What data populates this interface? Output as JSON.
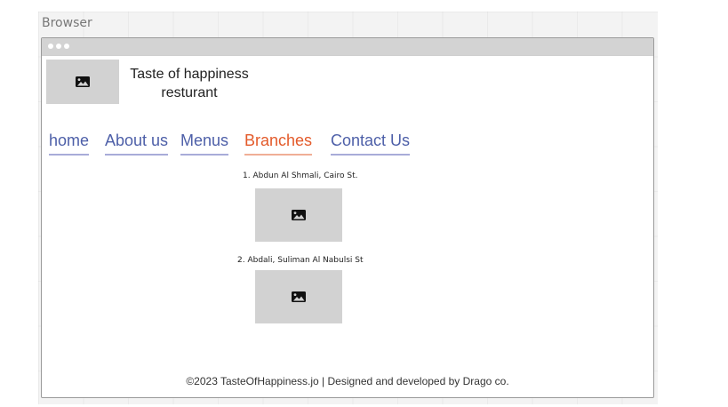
{
  "canvas": {
    "label": "Browser"
  },
  "site": {
    "title_line1": "Taste of happiness",
    "title_line2": "resturant"
  },
  "nav": {
    "items": [
      {
        "label": "home",
        "active": false
      },
      {
        "label": "About us",
        "active": false
      },
      {
        "label": "Menus",
        "active": false
      },
      {
        "label": "Branches",
        "active": true
      },
      {
        "label": "Contact Us",
        "active": false
      }
    ]
  },
  "branches": [
    {
      "label": "1. Abdun Al Shmali, Cairo St."
    },
    {
      "label": "2. Abdali, Suliman Al Nabulsi St"
    }
  ],
  "footer": {
    "text": "©2023 TasteOfHappiness.jo | Designed and developed by Drago co."
  },
  "colors": {
    "nav_link": "#4d5fa8",
    "nav_active": "#e35a2a",
    "image_placeholder": "#d2d2d2"
  },
  "icons": {
    "image_placeholder": "image-icon"
  }
}
